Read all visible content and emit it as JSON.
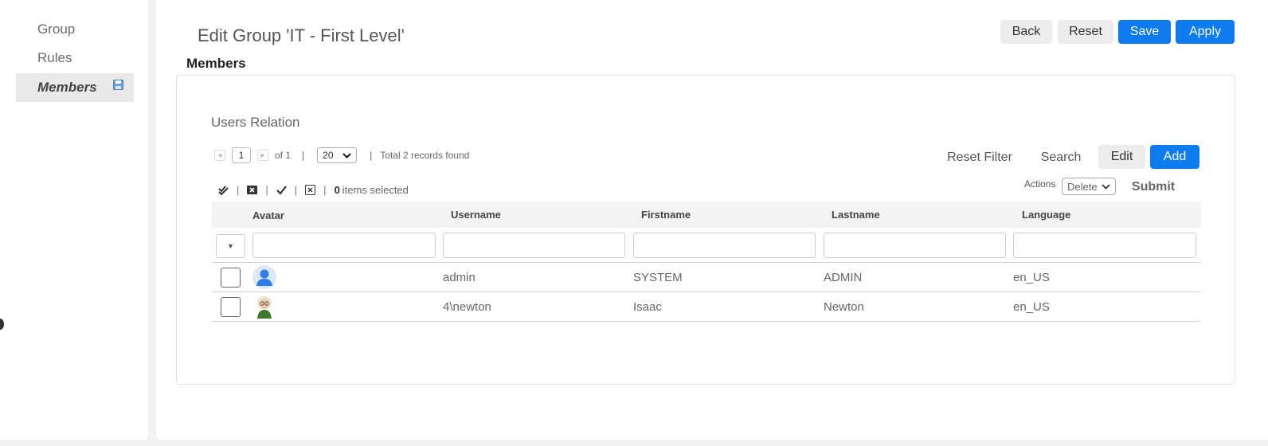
{
  "sidebar": {
    "items": [
      {
        "label": "Group"
      },
      {
        "label": "Rules"
      },
      {
        "label": "Members"
      }
    ]
  },
  "header": {
    "title": "Edit Group 'IT - First Level'",
    "section": "Members",
    "buttons": {
      "back": "Back",
      "reset": "Reset",
      "save": "Save",
      "apply": "Apply"
    }
  },
  "relation": {
    "title": "Users Relation",
    "pager": {
      "page": "1",
      "of_label": "of 1",
      "page_size": "20",
      "total": "Total 2 records found"
    },
    "toolbar": {
      "reset_filter": "Reset Filter",
      "search": "Search",
      "edit": "Edit",
      "add": "Add"
    },
    "selection": {
      "count": "0",
      "label": "items selected"
    },
    "actions": {
      "label": "Actions",
      "selected": "Delete",
      "submit": "Submit"
    },
    "columns": [
      "Avatar",
      "Username",
      "Firstname",
      "Lastname",
      "Language"
    ],
    "rows": [
      {
        "avatar": "default-user-avatar",
        "username": "admin",
        "firstname": "SYSTEM",
        "lastname": "ADMIN",
        "language": "en_US"
      },
      {
        "avatar": "newton-avatar",
        "username": "4\\newton",
        "firstname": "Isaac",
        "lastname": "Newton",
        "language": "en_US"
      }
    ]
  },
  "colors": {
    "primary": "#0d7cf0",
    "light_button": "#ececec",
    "background": "#f2f2f2"
  }
}
